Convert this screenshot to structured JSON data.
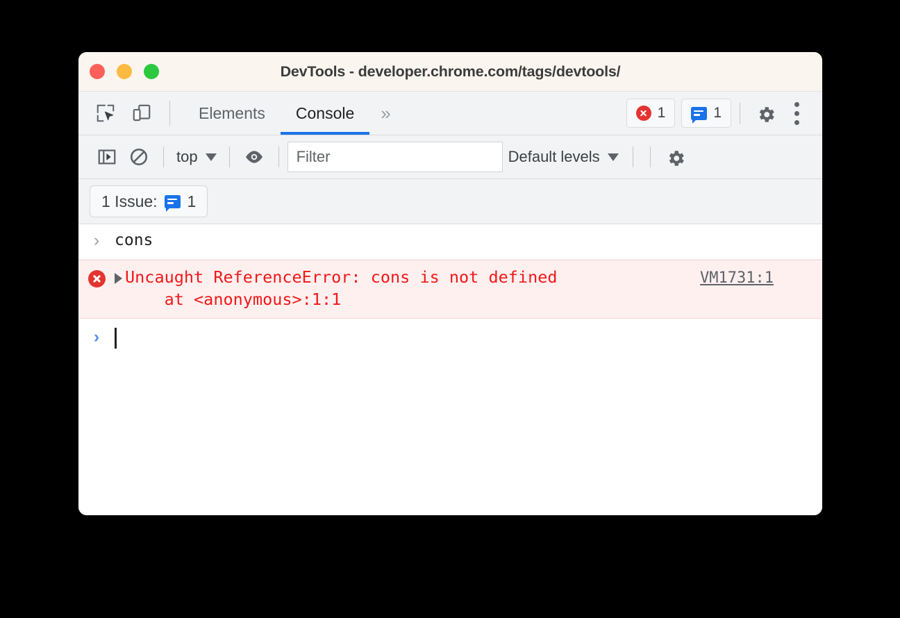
{
  "window": {
    "title": "DevTools - developer.chrome.com/tags/devtools/",
    "traffic_lights": [
      "close",
      "minimize",
      "maximize"
    ],
    "colors": {
      "titlebar_bg": "#faf6ef",
      "toolbar_bg": "#f1f3f4",
      "accent_blue": "#1a73e8",
      "error_red": "#e3342f",
      "error_text": "#f21818",
      "error_row_bg": "#fff0f0",
      "close_dot": "#fc6058",
      "minimize_dot": "#fcbb40",
      "maximize_dot": "#2bc840"
    }
  },
  "tabbar": {
    "inspect_icon": "inspect-element-icon",
    "device_icon": "device-toolbar-icon",
    "tabs": [
      {
        "label": "Elements",
        "selected": false
      },
      {
        "label": "Console",
        "selected": true
      }
    ],
    "overflow_label": "»",
    "error_count": "1",
    "error_icon": "error-circle-icon",
    "issue_count": "1",
    "issue_icon": "message-bubble-icon",
    "settings_icon": "gear-icon",
    "more_icon": "kebab-menu-icon"
  },
  "console_toolbar": {
    "sidebar_toggle_icon": "console-sidebar-icon",
    "clear_icon": "clear-console-icon",
    "context_label": "top",
    "context_caret": "▼",
    "live_expression_icon": "eye-icon",
    "filter_placeholder": "Filter",
    "filter_value": "",
    "levels_label": "Default levels",
    "levels_caret": "▼",
    "settings_icon": "gear-icon"
  },
  "issues_bar": {
    "label": "1 Issue:",
    "icon": "message-bubble-icon",
    "count": "1"
  },
  "console": {
    "command": {
      "prompt": "›",
      "text": "cons"
    },
    "error": {
      "icon": "error-circle-icon",
      "expand_icon": "expand-triangle-icon",
      "message_line1": "Uncaught ReferenceError: cons is not defined",
      "message_line2": "    at <anonymous>:1:1",
      "source_link": "VM1731:1"
    },
    "input_prompt": {
      "prompt": "›",
      "value": ""
    }
  }
}
